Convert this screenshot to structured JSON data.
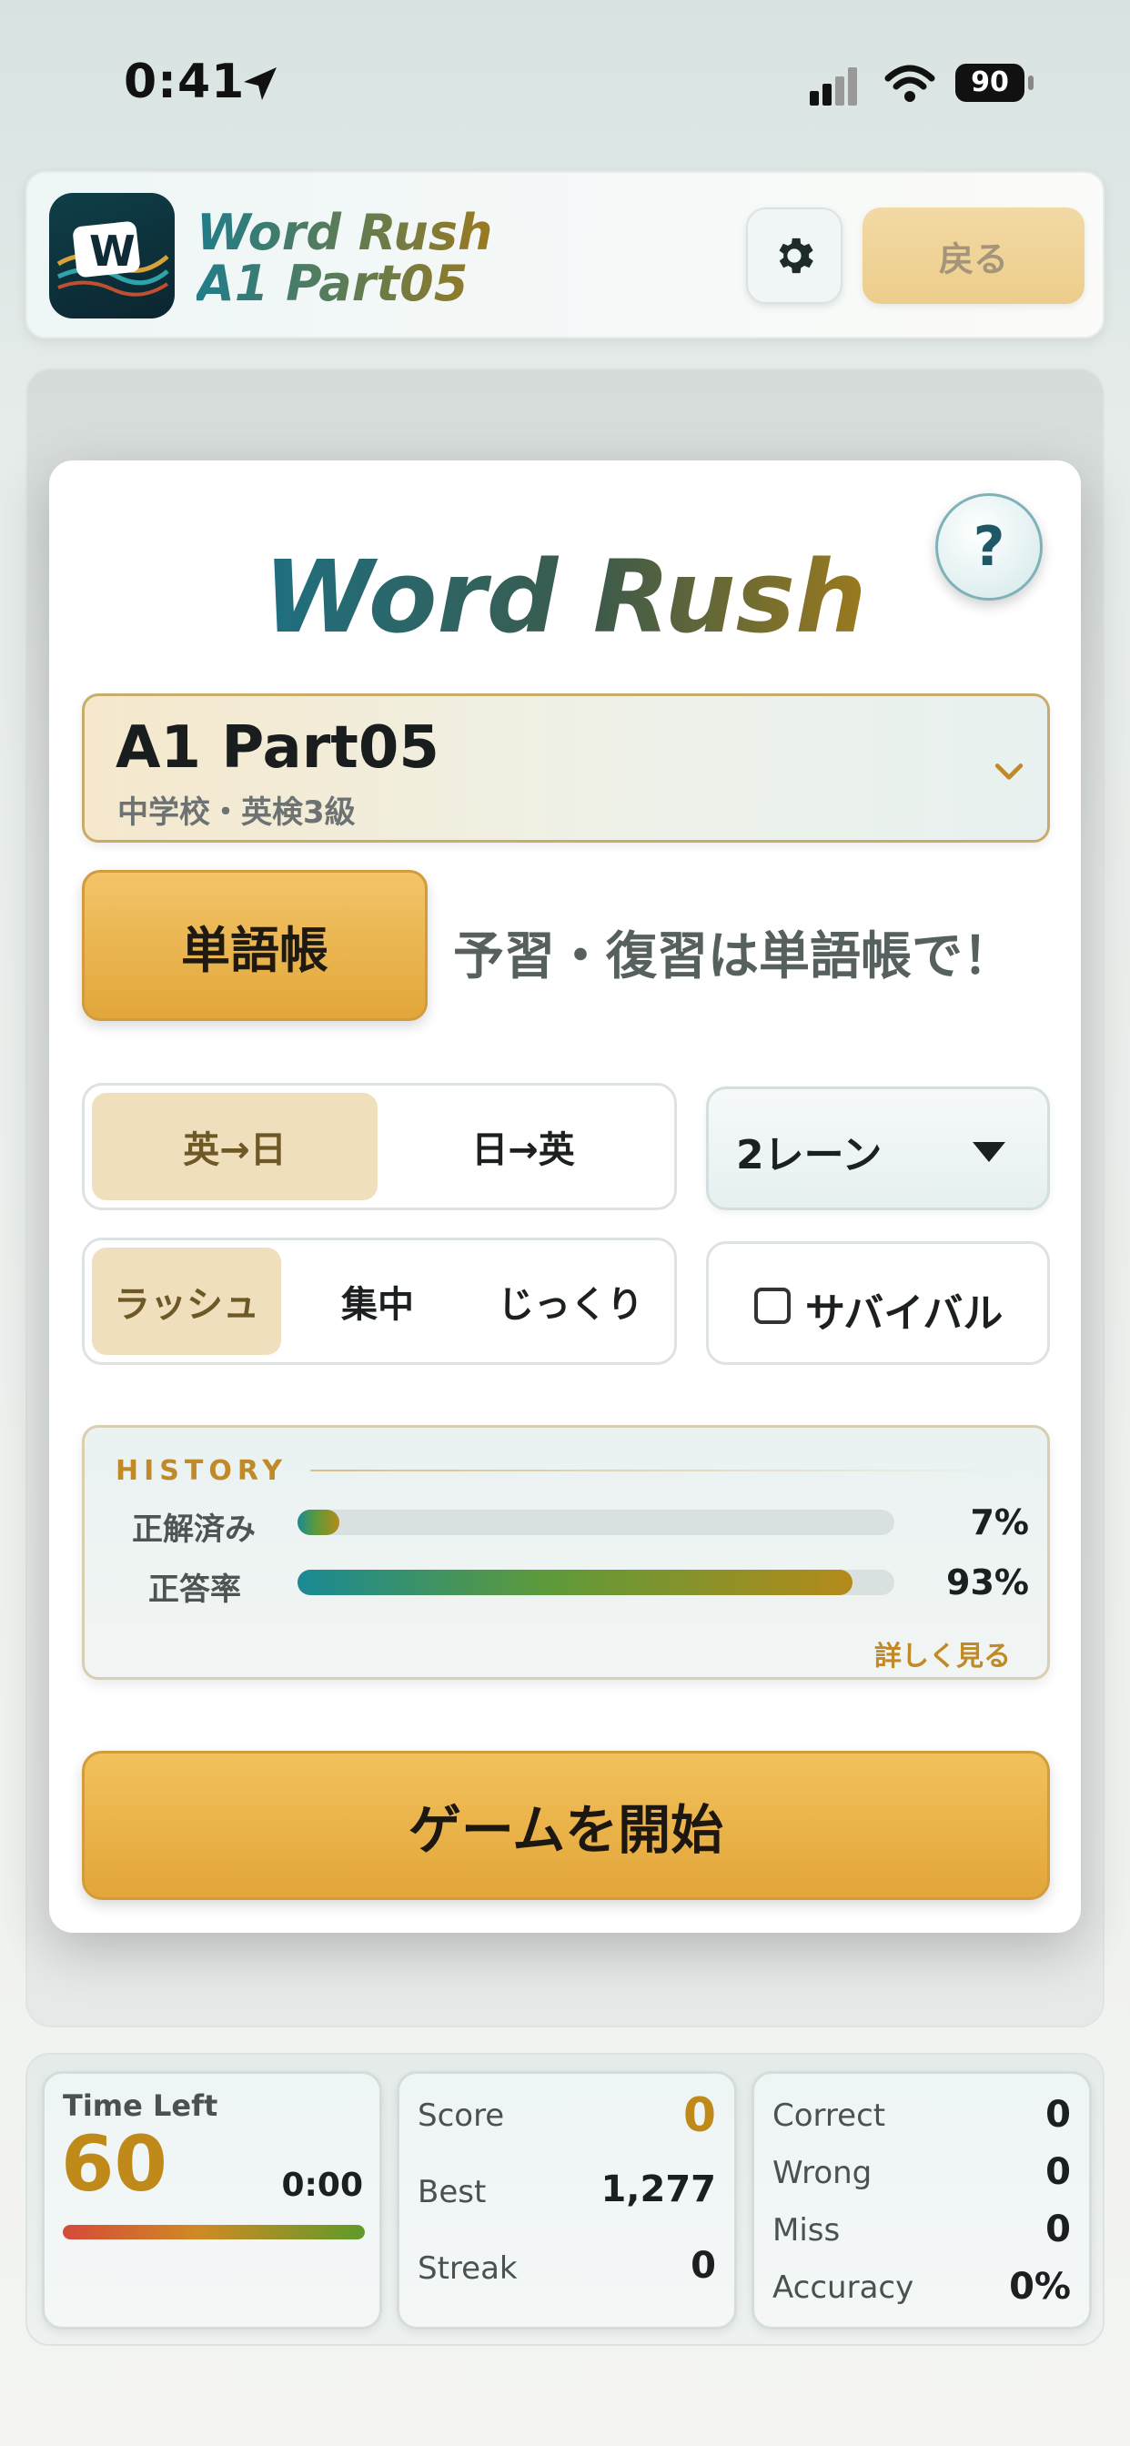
{
  "status_bar": {
    "time": "0:41",
    "battery": "90",
    "icons": [
      "location-arrow-icon",
      "cellular-signal-icon",
      "wifi-icon",
      "battery-icon"
    ]
  },
  "header": {
    "title_line1": "Word Rush",
    "title_line2": "A1 Part05",
    "back_label": "戻る",
    "settings_icon": "gear-icon",
    "logo_icon": "word-rush-logo",
    "logo_letter": "W"
  },
  "modal": {
    "title": "Word Rush",
    "help_label": "?",
    "set": {
      "name": "A1 Part05",
      "subtitle": "中学校・英検3級"
    },
    "wordbook_label": "単語帳",
    "wordbook_hint": "予習・復習は単語帳で！",
    "direction_options": [
      "英→日",
      "日→英"
    ],
    "direction_selected": 0,
    "lane_select": "2レーン",
    "mode_options": [
      "ラッシュ",
      "集中",
      "じっくり"
    ],
    "mode_selected": 0,
    "survival_label": "サバイバル",
    "survival_checked": false,
    "history": {
      "title": "HISTORY",
      "rows": [
        {
          "label": "正解済み",
          "value": "7%",
          "fraction": 0.07
        },
        {
          "label": "正答率",
          "value": "93%",
          "fraction": 0.93
        }
      ],
      "detail_link": "詳しく見る"
    },
    "start_label": "ゲームを開始"
  },
  "stats": {
    "time_left_label": "Time Left",
    "time_left_value": "60",
    "time_elapsed": "0:00",
    "time_fraction": 1.0,
    "score": [
      {
        "label": "Score",
        "value": "0"
      },
      {
        "label": "Best",
        "value": "1,277"
      },
      {
        "label": "Streak",
        "value": "0"
      }
    ],
    "counts": [
      {
        "label": "Correct",
        "value": "0"
      },
      {
        "label": "Wrong",
        "value": "0"
      },
      {
        "label": "Miss",
        "value": "0"
      },
      {
        "label": "Accuracy",
        "value": "0%"
      }
    ]
  },
  "colors": {
    "accent_gold": "#e2a63a",
    "accent_teal": "#1f7d8a",
    "score_gold": "#c08a1a"
  }
}
